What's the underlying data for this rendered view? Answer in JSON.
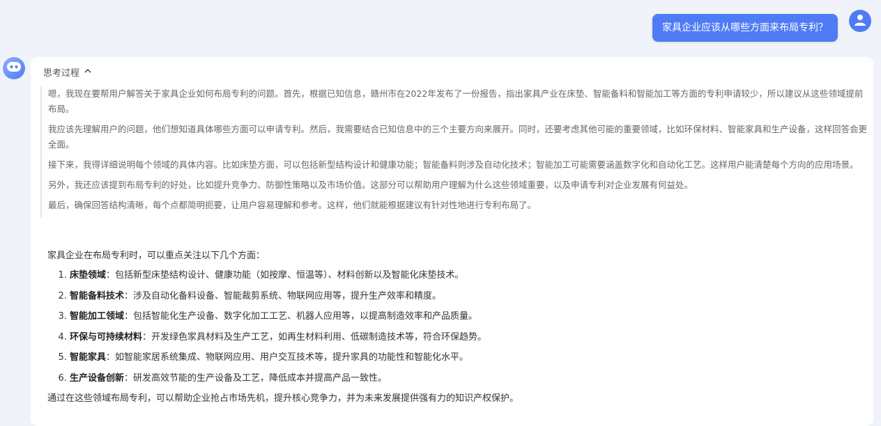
{
  "user_message": "家具企业应该从哪些方面来布局专利？",
  "thinking": {
    "toggle_label": "思考过程",
    "paragraphs": [
      "嗯，我现在要帮用户解答关于家具企业如何布局专利的问题。首先，根据已知信息，赣州市在2022年发布了一份报告，指出家具产业在床垫、智能备料和智能加工等方面的专利申请较少，所以建议从这些领域提前布局。",
      "我应该先理解用户的问题，他们想知道具体哪些方面可以申请专利。然后，我需要结合已知信息中的三个主要方向来展开。同时，还要考虑其他可能的重要领域，比如环保材料、智能家具和生产设备，这样回答会更全面。",
      "接下来，我得详细说明每个领域的具体内容。比如床垫方面，可以包括新型结构设计和健康功能；智能备料则涉及自动化技术；智能加工可能需要涵盖数字化和自动化工艺。这样用户能清楚每个方向的应用场景。",
      "另外，我还应该提到布局专利的好处，比如提升竞争力、防御性策略以及市场价值。这部分可以帮助用户理解为什么这些领域重要，以及申请专利对企业发展有何益处。",
      "最后，确保回答结构清晰，每个点都简明扼要，让用户容易理解和参考。这样，他们就能根据建议有针对性地进行专利布局了。"
    ]
  },
  "answer": {
    "intro": "家具企业在布局专利时，可以重点关注以下几个方面：",
    "items": [
      {
        "title": "床垫领域",
        "text": "：包括新型床垫结构设计、健康功能（如按摩、恒温等）、材料创新以及智能化床垫技术。"
      },
      {
        "title": "智能备料技术",
        "text": "：涉及自动化备料设备、智能裁剪系统、物联网应用等，提升生产效率和精度。"
      },
      {
        "title": "智能加工领域",
        "text": "：包括智能化生产设备、数字化加工工艺、机器人应用等，以提高制造效率和产品质量。"
      },
      {
        "title": "环保与可持续材料",
        "text": "：开发绿色家具材料及生产工艺，如再生材料利用、低碳制造技术等，符合环保趋势。"
      },
      {
        "title": "智能家具",
        "text": "：如智能家居系统集成、物联网应用、用户交互技术等，提升家具的功能性和智能化水平。"
      },
      {
        "title": "生产设备创新",
        "text": "：研发高效节能的生产设备及工艺，降低成本并提高产品一致性。"
      }
    ],
    "outro": "通过在这些领域布局专利，可以帮助企业抢占市场先机，提升核心竞争力，并为未来发展提供强有力的知识产权保护。"
  },
  "colors": {
    "accent": "#4f7cf4",
    "background": "#f0f3f9"
  },
  "icons": {
    "user_avatar": "user-icon",
    "bot_avatar": "bot-icon",
    "toggle": "chevron-up-icon"
  }
}
